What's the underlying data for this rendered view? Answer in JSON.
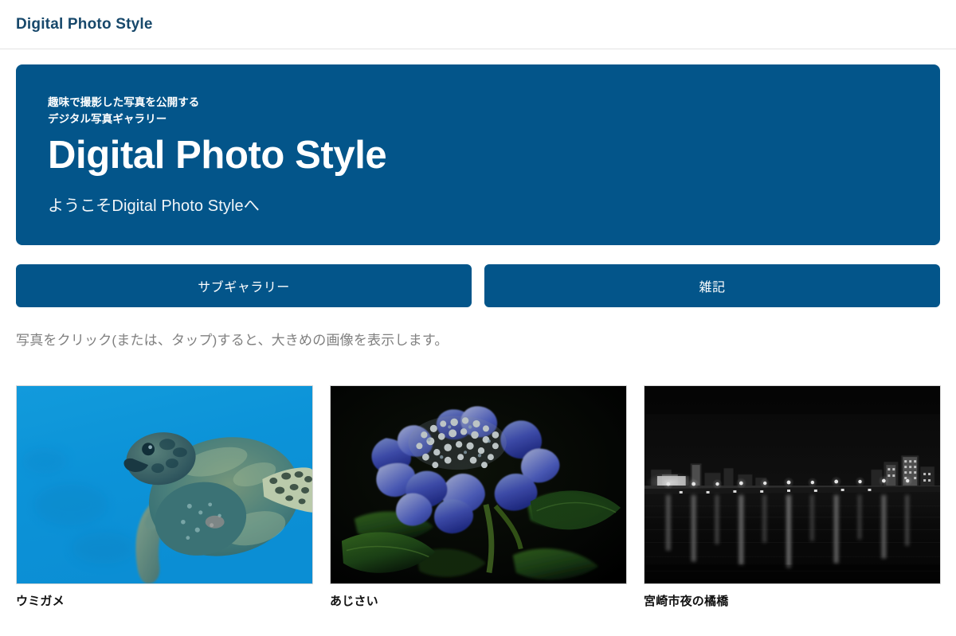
{
  "header": {
    "brand": "Digital Photo Style"
  },
  "hero": {
    "kicker_line1": "趣味で撮影した写真を公開する",
    "kicker_line2": "デジタル写真ギャラリー",
    "title": "Digital Photo Style",
    "welcome": "ようこそDigital Photo Styleへ",
    "background_color": "#03558a"
  },
  "nav": {
    "buttons": [
      {
        "label": "サブギャラリー"
      },
      {
        "label": "雑記"
      }
    ]
  },
  "note": "写真をクリック(または、タップ)すると、大きめの画像を表示します。",
  "gallery": {
    "items": [
      {
        "caption": "ウミガメ",
        "alt": "sea-turtle-photo"
      },
      {
        "caption": "あじさい",
        "alt": "hydrangea-photo"
      },
      {
        "caption": "宮崎市夜の橘橋",
        "alt": "night-bridge-photo"
      }
    ]
  },
  "colors": {
    "brand_text": "#17486b",
    "accent": "#03558a",
    "note_text": "#808080",
    "caption_text": "#111111"
  }
}
